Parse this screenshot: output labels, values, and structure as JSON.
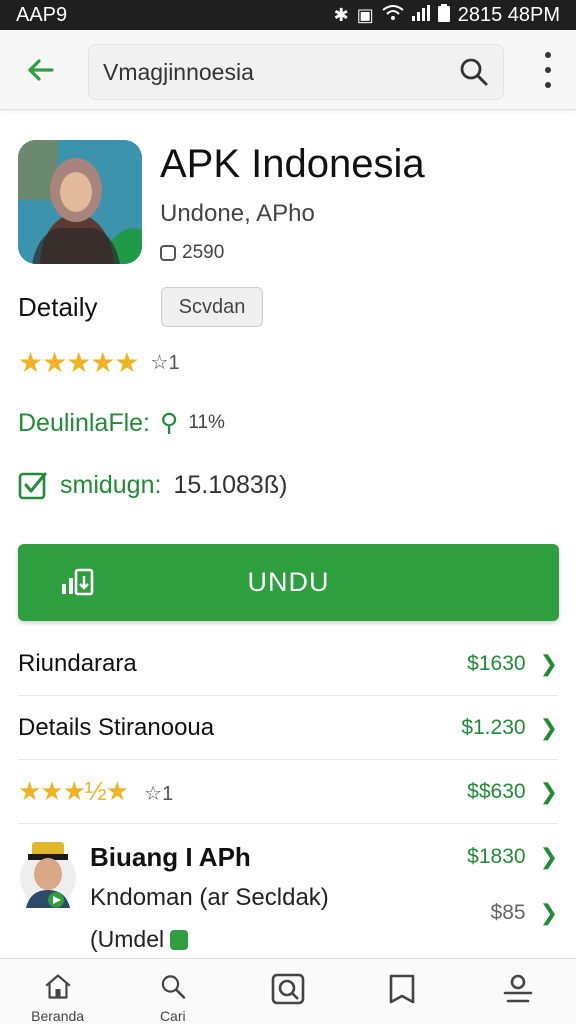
{
  "status_bar": {
    "left": "AAP9",
    "time": "2815 48PM"
  },
  "top_bar": {
    "search_value": "Vmagjinnoesia"
  },
  "app": {
    "title": "APK Indonesia",
    "developer": "Undone, APho",
    "size": "2590"
  },
  "details": {
    "label": "Detaily",
    "chip": "Scvdan",
    "rating_stars": 5,
    "rating_count": "1",
    "downloads_label": "DeulinlaFle:",
    "downloads_value": "11%",
    "check_label": "smidugn:",
    "check_value": "15.1083ß)"
  },
  "install_button": {
    "label": "UNDU"
  },
  "list": [
    {
      "label": "Riundarara",
      "value": "$1630"
    },
    {
      "label": "Details Stiranooua",
      "value": "$1.230"
    },
    {
      "stars": "★★★½★",
      "count": "1",
      "value": "$$630"
    }
  ],
  "review": {
    "name": "Biuang I APh",
    "subtitle": "Kndoman (ar Secldak)",
    "note": "(Umdel",
    "price1": "$1830",
    "price2": "$85"
  },
  "bottom_nav": {
    "items": [
      {
        "label": "Beranda",
        "icon": "home-icon"
      },
      {
        "label": "Cari",
        "icon": "search-icon"
      },
      {
        "label": "",
        "icon": "image-search-icon"
      },
      {
        "label": "",
        "icon": "book-icon"
      },
      {
        "label": "",
        "icon": "people-icon"
      }
    ]
  },
  "colors": {
    "accent_green": "#2e9e3e",
    "text_green": "#218c36",
    "star_yellow": "#f0b323"
  }
}
